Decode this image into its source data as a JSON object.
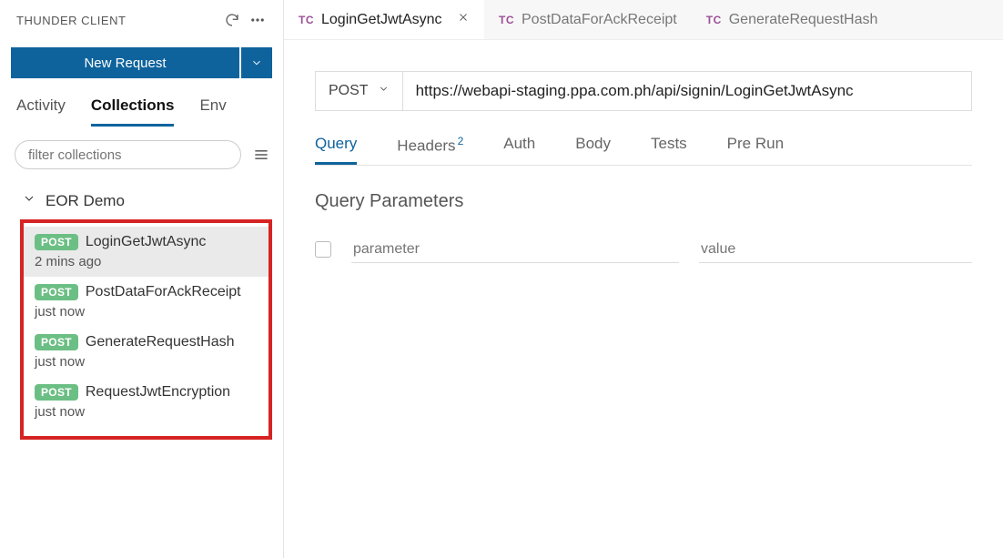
{
  "sidebar": {
    "title": "THUNDER CLIENT",
    "new_request_label": "New Request",
    "tabs": {
      "activity": "Activity",
      "collections": "Collections",
      "env": "Env"
    },
    "filter_placeholder": "filter collections",
    "collection_name": "EOR Demo",
    "requests": [
      {
        "method": "POST",
        "name": "LoginGetJwtAsync",
        "time": "2 mins ago",
        "active": true
      },
      {
        "method": "POST",
        "name": "PostDataForAckReceipt",
        "time": "just now",
        "active": false
      },
      {
        "method": "POST",
        "name": "GenerateRequestHash",
        "time": "just now",
        "active": false
      },
      {
        "method": "POST",
        "name": "RequestJwtEncryption",
        "time": "just now",
        "active": false
      }
    ]
  },
  "tabs": [
    {
      "prefix": "TC",
      "label": "LoginGetJwtAsync",
      "active": true
    },
    {
      "prefix": "TC",
      "label": "PostDataForAckReceipt",
      "active": false
    },
    {
      "prefix": "TC",
      "label": "GenerateRequestHash",
      "active": false
    }
  ],
  "request": {
    "method": "POST",
    "url": "https://webapi-staging.ppa.com.ph/api/signin/LoginGetJwtAsync",
    "tabs": {
      "query": "Query",
      "headers": "Headers",
      "headers_badge": "2",
      "auth": "Auth",
      "body": "Body",
      "tests": "Tests",
      "prerun": "Pre Run"
    },
    "section_title": "Query Parameters",
    "param_placeholder_name": "parameter",
    "param_placeholder_value": "value"
  }
}
